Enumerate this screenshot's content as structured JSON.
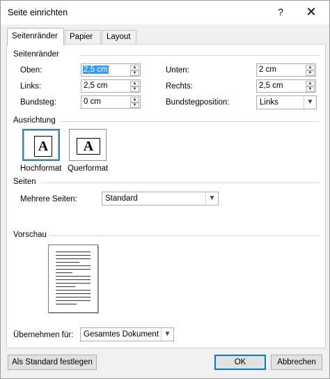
{
  "window": {
    "title": "Seite einrichten",
    "help": "?",
    "close": "✕"
  },
  "tabs": [
    {
      "label": "Seitenränder"
    },
    {
      "label": "Papier"
    },
    {
      "label": "Layout"
    }
  ],
  "margins": {
    "heading": "Seitenränder",
    "oben": {
      "label": "Oben:",
      "value": "2,5 cm"
    },
    "links": {
      "label": "Links:",
      "value": "2,5 cm"
    },
    "bundsteg": {
      "label": "Bundsteg:",
      "value": "0 cm"
    },
    "unten": {
      "label": "Unten:",
      "value": "2 cm"
    },
    "rechts": {
      "label": "Rechts:",
      "value": "2,5 cm"
    },
    "bundstegposition": {
      "label": "Bundstegposition:",
      "value": "Links"
    }
  },
  "orientation": {
    "heading": "Ausrichtung",
    "portrait_label": "Hochformat",
    "landscape_label": "Querformat",
    "glyph": "A"
  },
  "pages": {
    "heading": "Seiten",
    "multiple_label": "Mehrere Seiten:",
    "multiple_value": "Standard"
  },
  "preview": {
    "heading": "Vorschau"
  },
  "apply": {
    "label": "Übernehmen für:",
    "value": "Gesamtes Dokument"
  },
  "buttons": {
    "default": "Als Standard festlegen",
    "ok": "OK",
    "cancel": "Abbrechen"
  }
}
